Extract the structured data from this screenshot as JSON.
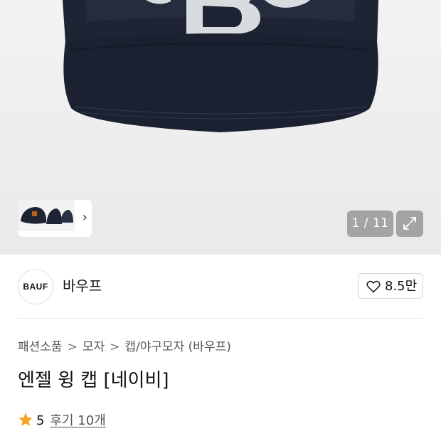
{
  "gallery": {
    "counter": "1 / 11",
    "thumbnail_label": "product-thumbnails"
  },
  "brand": {
    "logo_text": "BAUF",
    "name": "바우프",
    "likes": "8.5만"
  },
  "breadcrumb": {
    "items": [
      "패션소품",
      "모자",
      "캡/야구모자 (바우프)"
    ],
    "separator": ">"
  },
  "product": {
    "title": "엔젤 윙 캡 [네이비]"
  },
  "rating": {
    "score": "5",
    "reviews_label": "후기 10개"
  },
  "colors": {
    "cap": "#1c2232",
    "accent_star": "#f5a623"
  },
  "icons": [
    "chevron-right-icon",
    "expand-icon",
    "heart-icon",
    "star-icon"
  ]
}
